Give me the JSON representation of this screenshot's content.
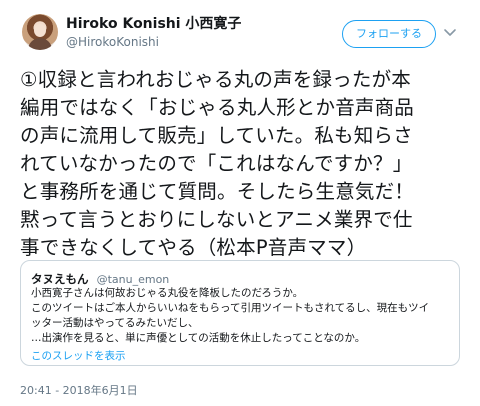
{
  "user": {
    "display_name": "Hiroko Konishi 小西寛子",
    "handle": "@HirokoKonishi"
  },
  "follow_button": "フォローする",
  "tweet": {
    "lines": [
      "①収録と言われおじゃる丸の声を録ったが本",
      "編用ではなく「おじゃる丸人形とか音声商品",
      "の声に流用して販売」していた。私も知らさ",
      "れていなかったので「これはなんですか？」",
      "と事務所を通じて質問。そしたら生意気だ！",
      "黙って言うとおりにしないとアニメ業界で仕",
      "事できなくしてやる（松本P音声ママ）"
    ]
  },
  "quote": {
    "name": "タヌえもん",
    "handle": "@tanu_emon",
    "lines": [
      "小西寛子さんは何故おじゃる丸役を降板したのだろうか。",
      "このツイートはご本人からいいねをもらって引用ツイートもされてるし、現在もツイ",
      "ッター活動はやってるみたいだし、",
      "…出演作を見ると、単に声優としての活動を休止したってことなのか。"
    ],
    "thread_link": "このスレッドを表示"
  },
  "timestamp": "20:41 - 2018年6月1日",
  "colors": {
    "accent": "#1da1f2",
    "text": "#14171a",
    "muted": "#657786",
    "border": "#ccd6dd"
  }
}
